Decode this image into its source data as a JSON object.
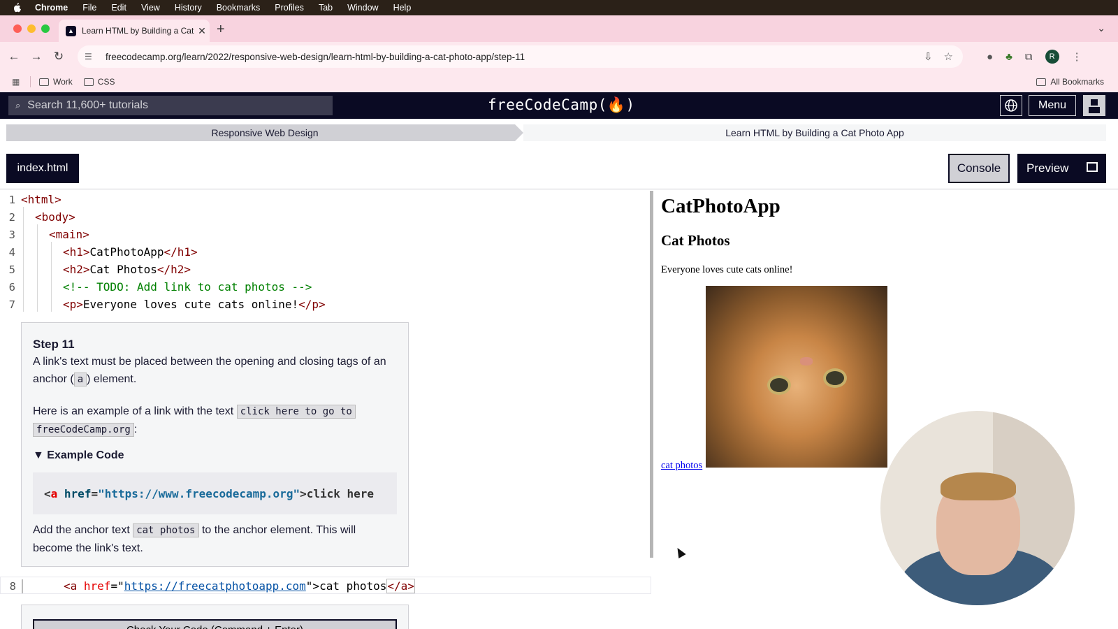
{
  "menubar": {
    "app": "Chrome",
    "items": [
      "File",
      "Edit",
      "View",
      "History",
      "Bookmarks",
      "Profiles",
      "Tab",
      "Window",
      "Help"
    ]
  },
  "browser": {
    "tab_title": "Learn HTML by Building a Cat",
    "url": "freecodecamp.org/learn/2022/responsive-web-design/learn-html-by-building-a-cat-photo-app/step-11",
    "profile_initial": "R",
    "bookmarks": [
      "Work",
      "CSS"
    ],
    "all_bookmarks": "All Bookmarks"
  },
  "fcc_nav": {
    "search_placeholder": "Search 11,600+ tutorials",
    "logo": "freeCodeCamp(🔥)",
    "menu": "Menu"
  },
  "breadcrumb": {
    "superblock": "Responsive Web Design",
    "block": "Learn HTML by Building a Cat Photo App"
  },
  "editor_toolbar": {
    "file_tab": "index.html",
    "console": "Console",
    "preview": "Preview"
  },
  "code_lines": {
    "l1": "<html>",
    "l2": "<body>",
    "l3": "<main>",
    "l4_open": "<h1>",
    "l4_text": "CatPhotoApp",
    "l4_close": "</h1>",
    "l5_open": "<h2>",
    "l5_text": "Cat Photos",
    "l5_close": "</h2>",
    "l6": "<!-- TODO: Add link to cat photos -->",
    "l7_open": "<p>",
    "l7_text": "Everyone loves cute cats online!",
    "l7_close": "</p>",
    "l8_open": "<a ",
    "l8_attr": "href",
    "l8_eq": "=\"",
    "l8_url": "https://freecatphotoapp.com",
    "l8_q": "\">",
    "l8_text": "cat photos",
    "l8_close": "</a>"
  },
  "step": {
    "title": "Step 11",
    "p1_a": "A link's text must be placed between the opening and closing tags of an anchor (",
    "p1_code": "a",
    "p1_b": ") element.",
    "p2_a": "Here is an example of a link with the text ",
    "p2_code1": "click here to go to",
    "p2_code2": "freeCodeCamp.org",
    "p2_b": ":",
    "details": "Example Code",
    "example_tag_open": "<",
    "example_a": "a",
    "example_attr": " href",
    "example_eq": "=",
    "example_str": "\"https://www.freecodecamp.org\"",
    "example_rest": ">click here",
    "p3_a": "Add the anchor text ",
    "p3_code": "cat photos",
    "p3_b": " to the anchor element. This will become the link's text.",
    "check_button": "Check Your Code (Command + Enter)"
  },
  "preview_pane": {
    "h1": "CatPhotoApp",
    "h2": "Cat Photos",
    "p": "Everyone loves cute cats online!",
    "link": "cat photos"
  },
  "line_numbers": [
    "1",
    "2",
    "3",
    "4",
    "5",
    "6",
    "7",
    "8"
  ]
}
